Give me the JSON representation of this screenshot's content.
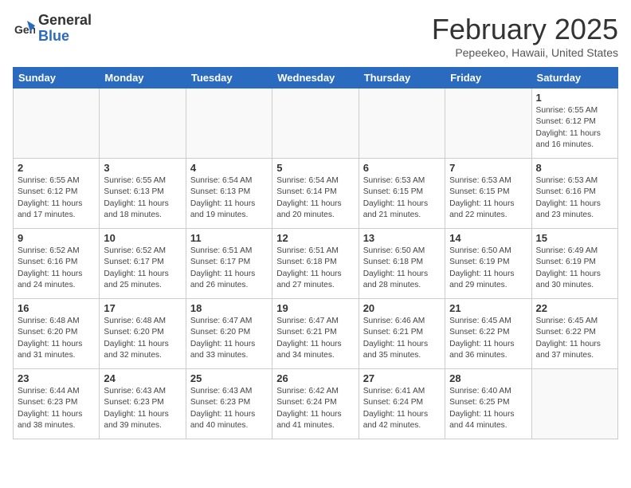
{
  "header": {
    "logo_general": "General",
    "logo_blue": "Blue",
    "month_title": "February 2025",
    "location": "Pepeekeo, Hawaii, United States"
  },
  "weekdays": [
    "Sunday",
    "Monday",
    "Tuesday",
    "Wednesday",
    "Thursday",
    "Friday",
    "Saturday"
  ],
  "weeks": [
    [
      {
        "day": "",
        "info": ""
      },
      {
        "day": "",
        "info": ""
      },
      {
        "day": "",
        "info": ""
      },
      {
        "day": "",
        "info": ""
      },
      {
        "day": "",
        "info": ""
      },
      {
        "day": "",
        "info": ""
      },
      {
        "day": "1",
        "info": "Sunrise: 6:55 AM\nSunset: 6:12 PM\nDaylight: 11 hours\nand 16 minutes."
      }
    ],
    [
      {
        "day": "2",
        "info": "Sunrise: 6:55 AM\nSunset: 6:12 PM\nDaylight: 11 hours\nand 17 minutes."
      },
      {
        "day": "3",
        "info": "Sunrise: 6:55 AM\nSunset: 6:13 PM\nDaylight: 11 hours\nand 18 minutes."
      },
      {
        "day": "4",
        "info": "Sunrise: 6:54 AM\nSunset: 6:13 PM\nDaylight: 11 hours\nand 19 minutes."
      },
      {
        "day": "5",
        "info": "Sunrise: 6:54 AM\nSunset: 6:14 PM\nDaylight: 11 hours\nand 20 minutes."
      },
      {
        "day": "6",
        "info": "Sunrise: 6:53 AM\nSunset: 6:15 PM\nDaylight: 11 hours\nand 21 minutes."
      },
      {
        "day": "7",
        "info": "Sunrise: 6:53 AM\nSunset: 6:15 PM\nDaylight: 11 hours\nand 22 minutes."
      },
      {
        "day": "8",
        "info": "Sunrise: 6:53 AM\nSunset: 6:16 PM\nDaylight: 11 hours\nand 23 minutes."
      }
    ],
    [
      {
        "day": "9",
        "info": "Sunrise: 6:52 AM\nSunset: 6:16 PM\nDaylight: 11 hours\nand 24 minutes."
      },
      {
        "day": "10",
        "info": "Sunrise: 6:52 AM\nSunset: 6:17 PM\nDaylight: 11 hours\nand 25 minutes."
      },
      {
        "day": "11",
        "info": "Sunrise: 6:51 AM\nSunset: 6:17 PM\nDaylight: 11 hours\nand 26 minutes."
      },
      {
        "day": "12",
        "info": "Sunrise: 6:51 AM\nSunset: 6:18 PM\nDaylight: 11 hours\nand 27 minutes."
      },
      {
        "day": "13",
        "info": "Sunrise: 6:50 AM\nSunset: 6:18 PM\nDaylight: 11 hours\nand 28 minutes."
      },
      {
        "day": "14",
        "info": "Sunrise: 6:50 AM\nSunset: 6:19 PM\nDaylight: 11 hours\nand 29 minutes."
      },
      {
        "day": "15",
        "info": "Sunrise: 6:49 AM\nSunset: 6:19 PM\nDaylight: 11 hours\nand 30 minutes."
      }
    ],
    [
      {
        "day": "16",
        "info": "Sunrise: 6:48 AM\nSunset: 6:20 PM\nDaylight: 11 hours\nand 31 minutes."
      },
      {
        "day": "17",
        "info": "Sunrise: 6:48 AM\nSunset: 6:20 PM\nDaylight: 11 hours\nand 32 minutes."
      },
      {
        "day": "18",
        "info": "Sunrise: 6:47 AM\nSunset: 6:20 PM\nDaylight: 11 hours\nand 33 minutes."
      },
      {
        "day": "19",
        "info": "Sunrise: 6:47 AM\nSunset: 6:21 PM\nDaylight: 11 hours\nand 34 minutes."
      },
      {
        "day": "20",
        "info": "Sunrise: 6:46 AM\nSunset: 6:21 PM\nDaylight: 11 hours\nand 35 minutes."
      },
      {
        "day": "21",
        "info": "Sunrise: 6:45 AM\nSunset: 6:22 PM\nDaylight: 11 hours\nand 36 minutes."
      },
      {
        "day": "22",
        "info": "Sunrise: 6:45 AM\nSunset: 6:22 PM\nDaylight: 11 hours\nand 37 minutes."
      }
    ],
    [
      {
        "day": "23",
        "info": "Sunrise: 6:44 AM\nSunset: 6:23 PM\nDaylight: 11 hours\nand 38 minutes."
      },
      {
        "day": "24",
        "info": "Sunrise: 6:43 AM\nSunset: 6:23 PM\nDaylight: 11 hours\nand 39 minutes."
      },
      {
        "day": "25",
        "info": "Sunrise: 6:43 AM\nSunset: 6:23 PM\nDaylight: 11 hours\nand 40 minutes."
      },
      {
        "day": "26",
        "info": "Sunrise: 6:42 AM\nSunset: 6:24 PM\nDaylight: 11 hours\nand 41 minutes."
      },
      {
        "day": "27",
        "info": "Sunrise: 6:41 AM\nSunset: 6:24 PM\nDaylight: 11 hours\nand 42 minutes."
      },
      {
        "day": "28",
        "info": "Sunrise: 6:40 AM\nSunset: 6:25 PM\nDaylight: 11 hours\nand 44 minutes."
      },
      {
        "day": "",
        "info": ""
      }
    ]
  ]
}
